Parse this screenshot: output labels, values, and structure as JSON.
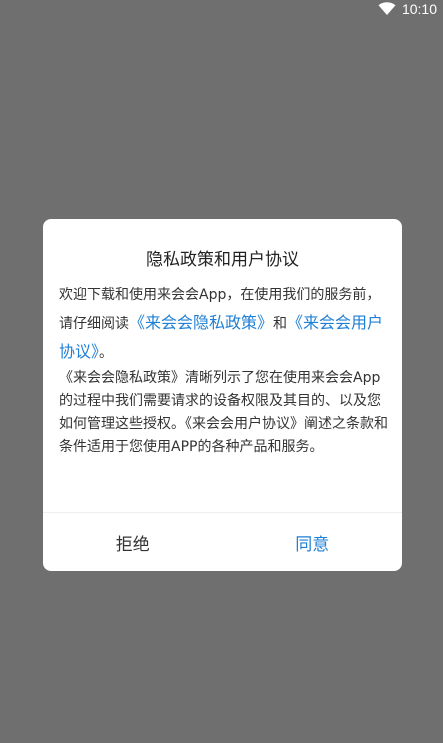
{
  "status_bar": {
    "time": "10:10",
    "icon": "wifi-icon"
  },
  "dialog": {
    "title": "隐私政策和用户协议",
    "para1_prefix": "欢迎下载和使用来会会App，在使用我们的服务前，请仔细阅读",
    "privacy_link": "《来会会隐私政策》",
    "para1_and": "和",
    "agreement_link": "《来会会用户协议》",
    "para1_suffix": "。",
    "para2": "《来会会隐私政策》清晰列示了您在使用来会会App的过程中我们需要请求的设备权限及其目的、以及您如何管理这些授权。《来会会用户协议》阐述之条款和条件适用于您使用APP的各种产品和服务。",
    "reject_label": "拒绝",
    "agree_label": "同意"
  },
  "colors": {
    "overlay": "#6f6f6f",
    "link": "#1e7fd6",
    "text": "#333333"
  }
}
